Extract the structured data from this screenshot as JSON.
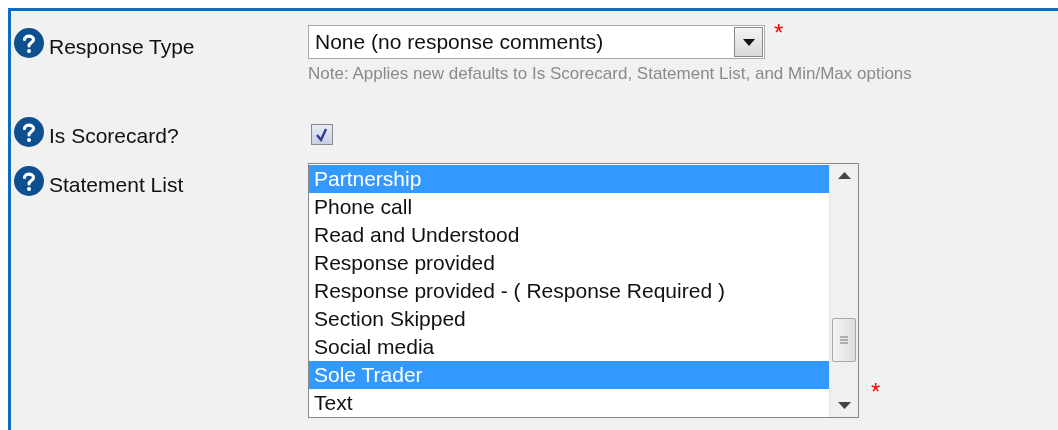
{
  "fields": [
    {
      "kind": "select",
      "label": "Response Type",
      "value": "None (no response comments)",
      "required_mark": "*",
      "note": "Note: Applies new defaults to Is Scorecard, Statement List, and Min/Max options"
    },
    {
      "kind": "checkbox",
      "label": "Is Scorecard?",
      "checked": true
    },
    {
      "kind": "listbox",
      "label": "Statement List",
      "required_mark": "*",
      "options": [
        {
          "label": "Partnership",
          "selected": true
        },
        {
          "label": "Phone call",
          "selected": false
        },
        {
          "label": "Read and Understood",
          "selected": false
        },
        {
          "label": "Response provided",
          "selected": false
        },
        {
          "label": "Response provided - ( Response Required )",
          "selected": false
        },
        {
          "label": "Section Skipped",
          "selected": false
        },
        {
          "label": "Social media",
          "selected": false
        },
        {
          "label": "Sole Trader",
          "selected": true
        },
        {
          "label": "Text",
          "selected": false
        }
      ]
    }
  ]
}
